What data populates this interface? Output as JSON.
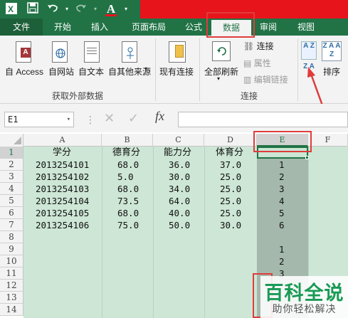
{
  "quick_access": {
    "font_color_glyph": "A"
  },
  "tabs": [
    {
      "label": "文件"
    },
    {
      "label": "开始"
    },
    {
      "label": "插入"
    },
    {
      "label": "页面布局"
    },
    {
      "label": "公式"
    },
    {
      "label": "数据"
    },
    {
      "label": "审阅"
    },
    {
      "label": "视图"
    }
  ],
  "ribbon": {
    "get_external": {
      "access": "自 Access",
      "web": "自网站",
      "text": "自文本",
      "other": "自其他来源",
      "group_label": "获取外部数据"
    },
    "existing": "现有连接",
    "connections": {
      "refresh_all": "全部刷新",
      "connect": "连接",
      "properties": "属性",
      "edit_links": "编辑链接",
      "group_label": "连接"
    },
    "sort": {
      "asc_icon_text": "A Z",
      "desc_icon_text": "Z A",
      "sort_label": "排序",
      "sort_icon_text": "Z A A Z"
    }
  },
  "formula_bar": {
    "name_box": "E1",
    "fx": "fx",
    "value": ""
  },
  "columns": [
    "A",
    "B",
    "C",
    "D",
    "E",
    "F"
  ],
  "rows": [
    "1",
    "2",
    "3",
    "4",
    "5",
    "6",
    "7",
    "8",
    "9",
    "10",
    "11",
    "12",
    "13",
    "14"
  ],
  "sheet": {
    "headers": {
      "A": "学分",
      "B": "德育分",
      "C": "能力分",
      "D": "体育分"
    },
    "data": [
      {
        "A": "2013254101",
        "B": "68.0",
        "C": "36.0",
        "D": "37.0",
        "E": "1"
      },
      {
        "A": "2013254102",
        "B": "5.0",
        "C": "30.0",
        "D": "25.0",
        "E": "2"
      },
      {
        "A": "2013254103",
        "B": "68.0",
        "C": "34.0",
        "D": "25.0",
        "E": "3"
      },
      {
        "A": "2013254104",
        "B": "73.5",
        "C": "64.0",
        "D": "25.0",
        "E": "4"
      },
      {
        "A": "2013254105",
        "B": "68.0",
        "C": "40.0",
        "D": "25.0",
        "E": "5"
      },
      {
        "A": "2013254106",
        "B": "75.0",
        "C": "50.0",
        "D": "30.0",
        "E": "6"
      }
    ],
    "extra_e": [
      "1",
      "2",
      "3"
    ]
  },
  "watermark": {
    "title": "百科全说",
    "subtitle": "助你轻松解决"
  },
  "colors": {
    "excel_green": "#217346",
    "highlight": "#e03c3c"
  }
}
